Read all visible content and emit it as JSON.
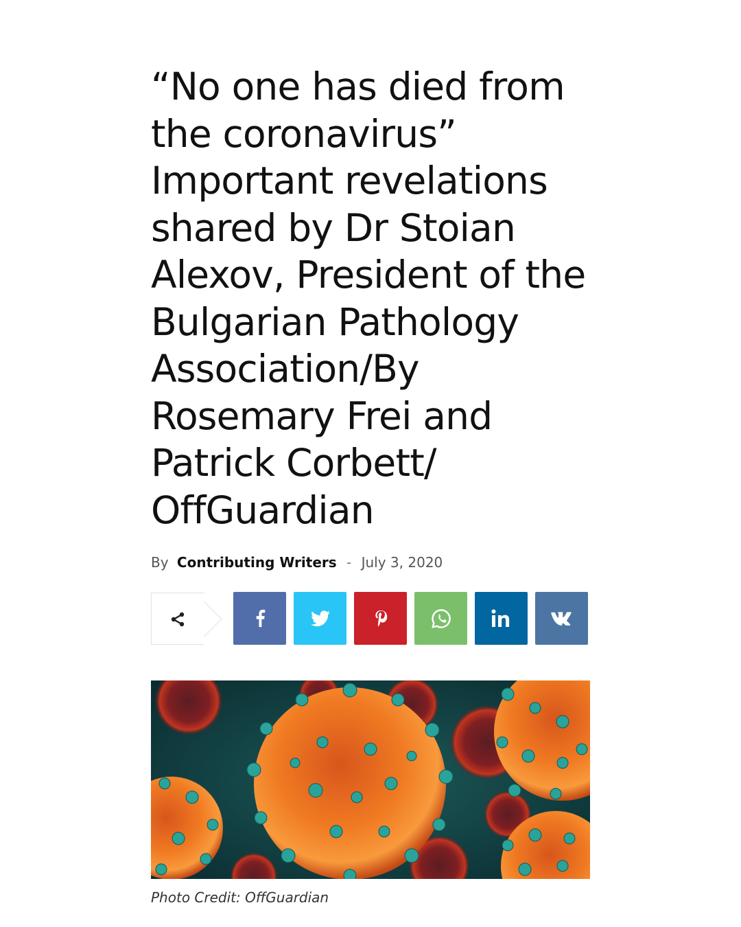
{
  "article": {
    "headline_lines": [
      "“No one has died from",
      "the coronavirus”",
      "Important revelations",
      "shared by Dr Stoian",
      "Alexov, President of the",
      "Bulgarian Pathology",
      "Association/By",
      "Rosemary Frei and",
      "Patrick Corbett/",
      "OffGuardian"
    ],
    "byline": {
      "prefix": "By",
      "author": "Contributing Writers",
      "separator": "-",
      "date": "July 3, 2020"
    },
    "photo_caption": "Photo Credit: OffGuardian"
  },
  "share_buttons": [
    {
      "name": "facebook",
      "icon": "facebook-icon",
      "color": "#516eab"
    },
    {
      "name": "twitter",
      "icon": "twitter-icon",
      "color": "#29c5f6"
    },
    {
      "name": "pinterest",
      "icon": "pinterest-icon",
      "color": "#ca212a"
    },
    {
      "name": "whatsapp",
      "icon": "whatsapp-icon",
      "color": "#7bbf6a"
    },
    {
      "name": "linkedin",
      "icon": "linkedin-icon",
      "color": "#0266a0"
    },
    {
      "name": "vk",
      "icon": "vk-icon",
      "color": "#4c75a3"
    }
  ],
  "colors": {
    "headline": "#111111",
    "byline": "#555555",
    "share_border": "#e2e2e2"
  }
}
